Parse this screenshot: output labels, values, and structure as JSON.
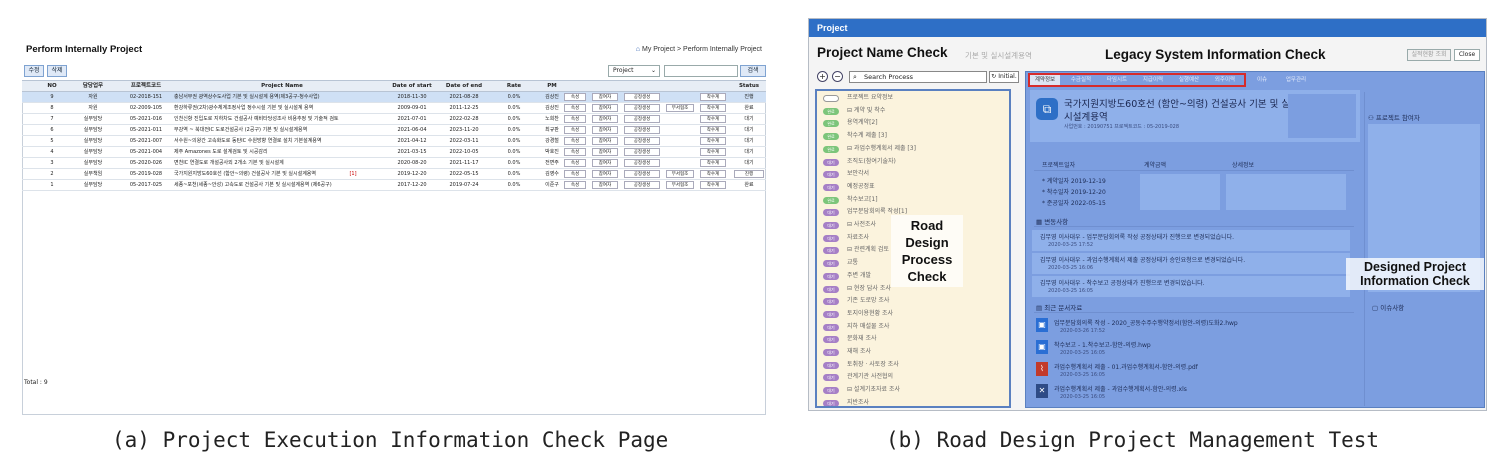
{
  "panelA": {
    "title": "Perform Internally Project",
    "breadcrumb": "My Project > Perform Internally Project",
    "toolbar": {
      "edit": "수정",
      "delete": "삭제",
      "filter": "Project",
      "search": "검색"
    },
    "columns": [
      "NO",
      "담당업무",
      "프로젝트코드",
      "Project Name",
      "Date of start",
      "Date of end",
      "Rate",
      "PM",
      "Status"
    ],
    "rows": [
      {
        "no": "9",
        "task": "자원",
        "code": "02-2018-151",
        "name": "충남서부권 광역상수도사업 기본 및 실시설계 용역(제3공구-청수사업)",
        "start": "2018-11-30",
        "end": "2021-08-28",
        "rate": "0.0%",
        "pm": "김상진",
        "b1": "속성",
        "b2": "참여자",
        "b3": "공정생성",
        "b4": "",
        "b5": "착수계",
        "status": "진행"
      },
      {
        "no": "8",
        "task": "자원",
        "code": "02-2009-105",
        "name": "환강하류권(2차)광수체계조정사업 정수시설 기본 및 실시설계 용역",
        "start": "2009-09-01",
        "end": "2011-12-25",
        "rate": "0.0%",
        "pm": "김상진",
        "b1": "속성",
        "b2": "참여자",
        "b3": "공정생성",
        "b4": "부서협조",
        "b5": "착수계",
        "status": "완료"
      },
      {
        "no": "7",
        "task": "실무담당",
        "code": "05-2021-016",
        "name": "인천신항 진입도로 지하차도 건설공사 예비타당성조사 비용추정 및 기술적 검토",
        "start": "2021-07-01",
        "end": "2022-02-28",
        "rate": "0.0%",
        "pm": "노희찬",
        "b1": "속성",
        "b2": "참여자",
        "b3": "공정생성",
        "b4": "",
        "b5": "착수계",
        "status": "대기"
      },
      {
        "no": "6",
        "task": "실무담당",
        "code": "05-2021-011",
        "name": "부강역 ~ 북대전IC 도로건설공사 (2공구) 기본 및 실시설계용역",
        "start": "2021-06-04",
        "end": "2023-11-20",
        "rate": "0.0%",
        "pm": "최규판",
        "b1": "속성",
        "b2": "참여자",
        "b3": "공정생성",
        "b4": "",
        "b5": "착수계",
        "status": "대기"
      },
      {
        "no": "5",
        "task": "실무담당",
        "code": "05-2021-007",
        "name": "서수원~의왕간 고속화도로 동탄IC 수원방향 연결로 설치 기본설계용역",
        "start": "2021-04-12",
        "end": "2022-03-11",
        "rate": "0.0%",
        "pm": "강경철",
        "b1": "속성",
        "b2": "참여자",
        "b3": "공정생성",
        "b4": "",
        "b5": "착수계",
        "status": "대기"
      },
      {
        "no": "4",
        "task": "실무담당",
        "code": "05-2021-004",
        "name": "제주 Amazones 도로 설계검토 및 시공감리",
        "start": "2021-03-15",
        "end": "2022-10-05",
        "rate": "0.0%",
        "pm": "박호진",
        "b1": "속성",
        "b2": "참여자",
        "b3": "공정생성",
        "b4": "",
        "b5": "착수계",
        "status": "대기"
      },
      {
        "no": "3",
        "task": "실무담당",
        "code": "05-2020-026",
        "name": "면천IC 연결도로 개설공사외 2개소 기본 및 실시설계",
        "start": "2020-08-20",
        "end": "2021-11-17",
        "rate": "0.0%",
        "pm": "전면주",
        "b1": "속성",
        "b2": "참여자",
        "b3": "공정생성",
        "b4": "",
        "b5": "착수계",
        "status": "대기"
      },
      {
        "no": "2",
        "task": "실무책임",
        "code": "05-2019-028",
        "name": "국가지원지방도60호선 (함안~의령) 건설공사 기본 및 실시설계용역",
        "flag": "[1]",
        "start": "2019-12-20",
        "end": "2022-05-15",
        "rate": "0.0%",
        "pm": "김영수",
        "b1": "속성",
        "b2": "참여자",
        "b3": "공정생성",
        "b4": "부서협조",
        "b5": "착수계",
        "status": "진행"
      },
      {
        "no": "1",
        "task": "실무담당",
        "code": "05-2017-025",
        "name": "세종~포천(세종~안성) 고속도로 건설공사 기본 및 실시설계용역 (제6공구)",
        "start": "2017-12-20",
        "end": "2019-07-24",
        "rate": "0.0%",
        "pm": "이준구",
        "b1": "속성",
        "b2": "참여자",
        "b3": "공정생성",
        "b4": "부서협조",
        "b5": "착수계",
        "status": "완료"
      }
    ],
    "total": "Total : 9"
  },
  "panelB": {
    "appTitle": "Project",
    "projectNameCheck": "Project Name Check",
    "ghostTitle": "기본 및 실시설계용역",
    "legacyCheck": "Legacy System Information Check",
    "btnView": "실적현황 조회",
    "btnClose": "Close",
    "searchPlaceholder": "Search Process",
    "initialBtn": "Initial.",
    "treeItems": [
      {
        "pill": "",
        "label": "프로젝트 요약정보"
      },
      {
        "pill": "완료",
        "label": "⊟ 계약 및 착수"
      },
      {
        "pill": "완료",
        "label": "  용역계약[2]"
      },
      {
        "pill": "완료",
        "label": "  착수계 제출 [3]"
      },
      {
        "pill": "완료",
        "label": "⊟ 과업수행계획서 제출 [3]"
      },
      {
        "pill": "대기",
        "label": "  조직도(참여기술자)"
      },
      {
        "pill": "대기",
        "label": "  보안각서"
      },
      {
        "pill": "대기",
        "label": "  예정공정표"
      },
      {
        "pill": "완료",
        "label": "  착수보고[1]"
      },
      {
        "pill": "대기",
        "label": "  업무분담회의록 작성[1]"
      },
      {
        "pill": "대기",
        "label": "⊟ 사전조사"
      },
      {
        "pill": "대기",
        "label": "  자료조사"
      },
      {
        "pill": "대기",
        "label": "⊟ 관련계획 검토"
      },
      {
        "pill": "대기",
        "label": "  교통"
      },
      {
        "pill": "대기",
        "label": "  주변 개발"
      },
      {
        "pill": "대기",
        "label": "⊟ 현장 답사 조사"
      },
      {
        "pill": "대기",
        "label": "  기존 도로망 조사"
      },
      {
        "pill": "대기",
        "label": "  토지이용현황 조사"
      },
      {
        "pill": "대기",
        "label": "  지하 매설물 조사"
      },
      {
        "pill": "대기",
        "label": "  문화재 조사"
      },
      {
        "pill": "대기",
        "label": "  재해 조사"
      },
      {
        "pill": "대기",
        "label": "  토취장 · 사토장 조사"
      },
      {
        "pill": "대기",
        "label": "  관계기관 사전협의"
      },
      {
        "pill": "대기",
        "label": "⊟ 설계기초자료 조사"
      },
      {
        "pill": "대기",
        "label": "  지반조사"
      }
    ],
    "roadOverlay": [
      "Road",
      "Design",
      "Process",
      "Check"
    ],
    "tabs": [
      "계약정보",
      "수금실적",
      "타임시트",
      "지급이력",
      "실행예산",
      "외주이력",
      "이슈",
      "업무관리"
    ],
    "projectTitle": [
      "국가지원지방도60호선 (함안~의령) 건설공사 기본 및 실",
      "시설계용역"
    ],
    "projectCodes": "사업번호 : 20190751   프로젝트코드 : 05-2019-028",
    "participant": "프로젝트 참여자",
    "dateHeader": [
      "프로젝트일자",
      "계약금액",
      "상세정보"
    ],
    "dates": [
      "* 계약일자  2019-12-19",
      "* 착수일자  2019-12-20",
      "* 준공일자  2022-05-15"
    ],
    "changes": "변동사항",
    "changeItems": [
      {
        "text": "김무영 이사대우 - 업무분담회의록 작성 공정상태가 진행으로 변경되었습니다.",
        "time": "2020-03-25 17:52"
      },
      {
        "text": "김무영 이사대우 - 과업수행계획서 제출 공정상태가 승인요청으로 변경되었습니다.",
        "time": "2020-03-25 16:06"
      },
      {
        "text": "김무영 이사대우 - 착수보고 공정상태가 진행으로 변경되었습니다.",
        "time": "2020-03-25 16:05"
      }
    ],
    "docs": "최근 문서자료",
    "docItems": [
      {
        "text": "업무분담회의록 작성 - 2020_공동수주수행약정서(함안-의령)도화2.hwp",
        "time": "2020-03-26 17:52"
      },
      {
        "text": "착수보고 - 1.착수보고-함안-의령.hwp",
        "time": "2020-03-25 16:05"
      },
      {
        "text": "과업수행계획서 제출 - 01.과업수행계획서-함안-의령.pdf",
        "time": "2020-03-25 16:05"
      },
      {
        "text": "과업수행계획서 제출 - 과업수행계획서-함안-의령.xls",
        "time": "2020-03-25 16:05"
      }
    ],
    "issues": "이슈사항",
    "designedOverlay": "Designed Project Information Check"
  },
  "captions": {
    "a": "(a) Project Execution Information Check Page",
    "b": "(b) Road Design Project Management Test"
  },
  "colors": {
    "accent": "#2e6fc6",
    "overlay": "#7c9ee0",
    "highlight": "#d62b2b",
    "tree": "#fbf3dd"
  }
}
